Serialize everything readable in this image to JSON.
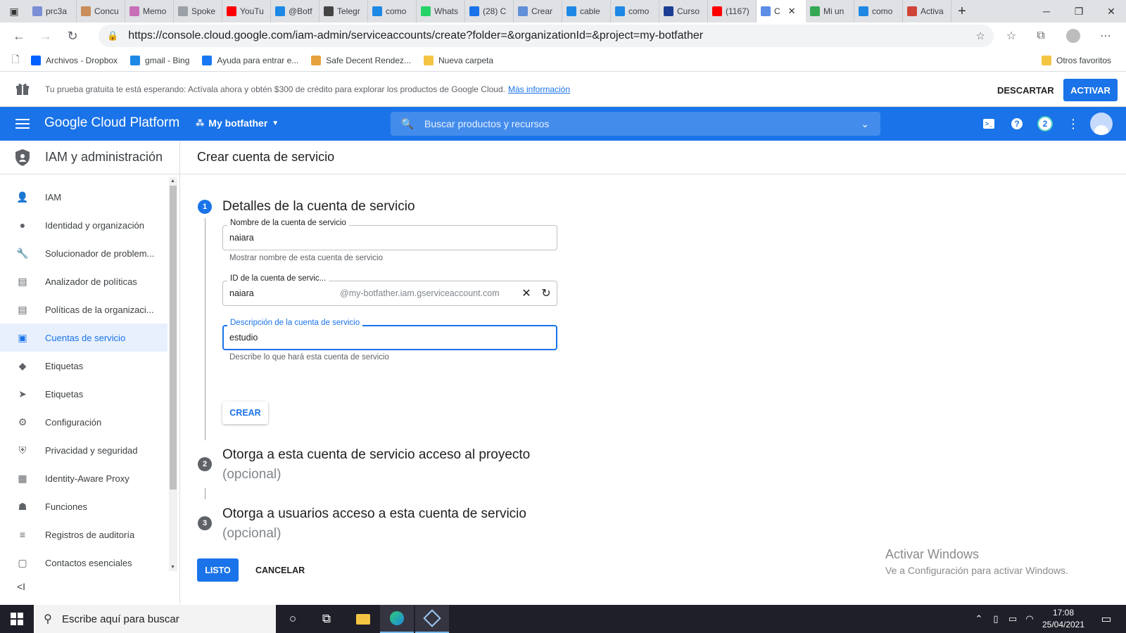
{
  "browser": {
    "tabs": [
      {
        "title": "prc3a",
        "color": "#7b8ed6"
      },
      {
        "title": "Concu",
        "color": "#c98d5b"
      },
      {
        "title": "Memo",
        "color": "#c96fb7"
      },
      {
        "title": "Spoke",
        "color": "#9aa0a6"
      },
      {
        "title": "YouTu",
        "color": "#ff0000"
      },
      {
        "title": "@Botf",
        "color": "#1e88e5"
      },
      {
        "title": "Telegr",
        "color": "#444444"
      },
      {
        "title": "como",
        "color": "#1e88e5"
      },
      {
        "title": "Whats",
        "color": "#25d366"
      },
      {
        "title": "(28) C",
        "color": "#1a73e8"
      },
      {
        "title": "Crear",
        "color": "#5f8fd6"
      },
      {
        "title": "cable",
        "color": "#1e88e5"
      },
      {
        "title": "como",
        "color": "#1e88e5"
      },
      {
        "title": "Curso",
        "color": "#1c3f94"
      },
      {
        "title": "(1167)",
        "color": "#ff0000"
      },
      {
        "title": "C",
        "color": "#5c8ee6",
        "active": true
      },
      {
        "title": "Mi un",
        "color": "#34a853"
      },
      {
        "title": "como",
        "color": "#1e88e5"
      },
      {
        "title": "Activa",
        "color": "#d04437"
      }
    ],
    "url": "https://console.cloud.google.com/iam-admin/serviceaccounts/create?folder=&organizationId=&project=my-botfather",
    "bookmarks": [
      {
        "label": "Archivos - Dropbox",
        "color": "#0061ff"
      },
      {
        "label": "gmail - Bing",
        "color": "#1e88e5"
      },
      {
        "label": "Ayuda para entrar e...",
        "color": "#1877f2"
      },
      {
        "label": "Safe Decent Rendez...",
        "color": "#e6a23c"
      },
      {
        "label": "Nueva carpeta",
        "color": "#f4c542"
      }
    ],
    "other_bookmarks": "Otros favoritos"
  },
  "trial": {
    "message": "Tu prueba gratuita te está esperando: Actívala ahora y obtén $300 de crédito para explorar los productos de Google Cloud.",
    "link": "Más información",
    "dismiss": "DESCARTAR",
    "activate": "ACTIVAR"
  },
  "header": {
    "brand": "Google Cloud Platform",
    "project": "My botfather",
    "search_placeholder": "Buscar productos y recursos",
    "notifications": "2"
  },
  "sidebar": {
    "title": "IAM y administración",
    "items": [
      {
        "label": "IAM",
        "icon": "person-add-icon",
        "glyph": "👤"
      },
      {
        "label": "Identidad y organización",
        "icon": "account-circle-icon",
        "glyph": "●"
      },
      {
        "label": "Solucionador de problem...",
        "icon": "wrench-icon",
        "glyph": "🔧"
      },
      {
        "label": "Analizador de políticas",
        "icon": "policy-analyzer-icon",
        "glyph": "▤"
      },
      {
        "label": "Políticas de la organizaci...",
        "icon": "list-icon",
        "glyph": "▤"
      },
      {
        "label": "Cuentas de servicio",
        "icon": "service-account-icon",
        "glyph": "▣",
        "active": true
      },
      {
        "label": "Etiquetas",
        "icon": "label-icon",
        "glyph": "◆"
      },
      {
        "label": "Etiquetas",
        "icon": "tag-icon",
        "glyph": "➤"
      },
      {
        "label": "Configuración",
        "icon": "gear-icon",
        "glyph": "⚙"
      },
      {
        "label": "Privacidad y seguridad",
        "icon": "shield-icon",
        "glyph": "⛨"
      },
      {
        "label": "Identity-Aware Proxy",
        "icon": "proxy-icon",
        "glyph": "▦"
      },
      {
        "label": "Funciones",
        "icon": "roles-icon",
        "glyph": "☗"
      },
      {
        "label": "Registros de auditoría",
        "icon": "audit-logs-icon",
        "glyph": "≡"
      },
      {
        "label": "Contactos esenciales",
        "icon": "contacts-icon",
        "glyph": "▢"
      }
    ]
  },
  "main": {
    "title": "Crear cuenta de servicio",
    "step1": {
      "number": "1",
      "title": "Detalles de la cuenta de servicio",
      "name_label": "Nombre de la cuenta de servicio",
      "name_value": "naiara",
      "name_hint": "Mostrar nombre de esta cuenta de servicio",
      "id_label": "ID de la cuenta de servic...",
      "id_value": "naiara",
      "id_suffix": "@my-botfather.iam.gserviceaccount.com",
      "desc_label": "Descripción de la cuenta de servicio",
      "desc_value": "estudio",
      "desc_hint": "Describe lo que hará esta cuenta de servicio",
      "create": "CREAR"
    },
    "step2": {
      "number": "2",
      "title": "Otorga a esta cuenta de servicio acceso al proyecto",
      "optional": "(opcional)"
    },
    "step3": {
      "number": "3",
      "title": "Otorga a usuarios acceso a esta cuenta de servicio",
      "optional": "(opcional)"
    },
    "done": "LISTO",
    "cancel": "CANCELAR"
  },
  "watermark": {
    "line1": "Activar Windows",
    "line2": "Ve a Configuración para activar Windows."
  },
  "taskbar": {
    "search_placeholder": "Escribe aquí para buscar",
    "time": "17:08",
    "date": "25/04/2021"
  },
  "colors": {
    "accent": "#1a73e8",
    "header": "#1a73e8",
    "taskbar": "#1f1f2a"
  }
}
